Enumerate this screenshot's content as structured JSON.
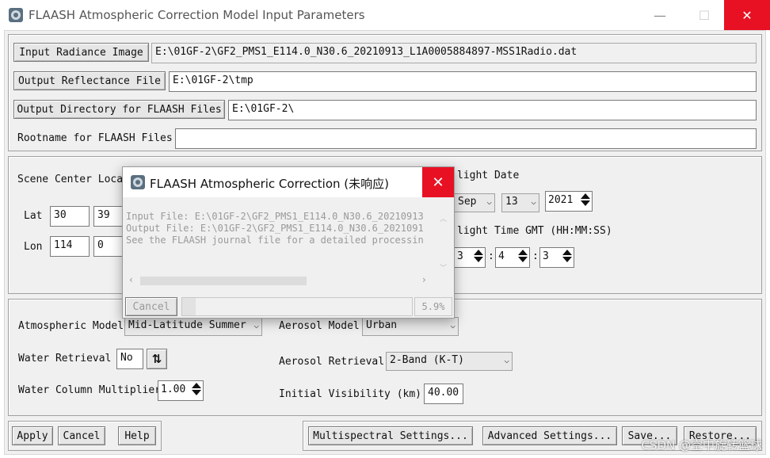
{
  "window": {
    "title": "FLAASH Atmospheric Correction Model Input Parameters",
    "minimize": "—",
    "maximize": "☐",
    "close": "✕"
  },
  "files": {
    "input_button": "Input Radiance Image",
    "input_value": "E:\\01GF-2\\GF2_PMS1_E114.0_N30.6_20210913_L1A0005884897-MSS1Radio.dat",
    "output_button": "Output Reflectance File",
    "output_value": "E:\\01GF-2\\tmp",
    "outdir_button": "Output Directory for FLAASH Files",
    "outdir_value": "E:\\01GF-2\\",
    "rootname_label": "Rootname for FLAASH Files",
    "rootname_value": ""
  },
  "scene": {
    "center_label": "Scene Center Locat",
    "lat_label": "Lat",
    "lat_deg": "30",
    "lat_min": "39",
    "lon_label": "Lon",
    "lon_deg": "114",
    "lon_min": "0",
    "flight_date_label": "light Date",
    "month": "Sep",
    "day": "13",
    "year": "2021",
    "flight_time_label": "light Time GMT (HH:MM:SS)",
    "hour": "3",
    "minute": "4",
    "second": "3",
    "sep": ":"
  },
  "atmosphere": {
    "model_label": "Atmospheric Model",
    "model_value": "Mid-Latitude Summer",
    "water_retrieval_label": "Water Retrieval",
    "water_retrieval_value": "No",
    "water_multiplier_label": "Water Column Multiplier",
    "water_multiplier_value": "1.00",
    "aerosol_model_label": "Aerosol Model",
    "aerosol_model_value": "Urban",
    "aerosol_retrieval_label": "Aerosol Retrieval",
    "aerosol_retrieval_value": "2-Band (K-T)",
    "visibility_label": "Initial Visibility (km)",
    "visibility_value": "40.00"
  },
  "footer": {
    "apply": "Apply",
    "cancel": "Cancel",
    "help": "Help",
    "multispectral": "Multispectral Settings...",
    "advanced": "Advanced Settings...",
    "save": "Save...",
    "restore": "Restore..."
  },
  "dialog": {
    "title": "FLAASH Atmospheric Correction (未响应)",
    "close": "✕",
    "line1": "Input File: E:\\01GF-2\\GF2_PMS1_E114.0_N30.6_20210913",
    "line2": "Output File: E:\\01GF-2\\GF2_PMS1_E114.0_N30.6_2021091",
    "line3": "See the FLAASH journal file for a detailed processin",
    "cancel": "Cancel",
    "progress_text": "5.9%",
    "progress_fraction": 0.059
  },
  "watermark": "CSDN @空中旋转篮球"
}
